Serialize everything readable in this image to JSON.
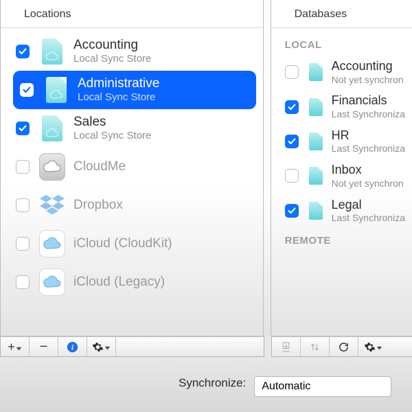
{
  "left": {
    "header": "Locations",
    "items": [
      {
        "title": "Accounting",
        "subtitle": "Local Sync Store",
        "checked": true,
        "icon": "cloud-doc",
        "selected": false,
        "dim": false
      },
      {
        "title": "Administrative",
        "subtitle": "Local Sync Store",
        "checked": true,
        "icon": "cloud-doc",
        "selected": true,
        "dim": false
      },
      {
        "title": "Sales",
        "subtitle": "Local Sync Store",
        "checked": true,
        "icon": "cloud-doc",
        "selected": false,
        "dim": false
      },
      {
        "title": "CloudMe",
        "subtitle": "",
        "checked": false,
        "icon": "cloudme",
        "selected": false,
        "dim": true
      },
      {
        "title": "Dropbox",
        "subtitle": "",
        "checked": false,
        "icon": "dropbox",
        "selected": false,
        "dim": true
      },
      {
        "title": "iCloud (CloudKit)",
        "subtitle": "",
        "checked": false,
        "icon": "icloud",
        "selected": false,
        "dim": true
      },
      {
        "title": "iCloud (Legacy)",
        "subtitle": "",
        "checked": false,
        "icon": "icloud",
        "selected": false,
        "dim": true
      }
    ],
    "toolbar": {
      "add": "+",
      "remove": "−",
      "info": "i",
      "gear": "gear"
    }
  },
  "right": {
    "header": "Databases",
    "section_local": "LOCAL",
    "section_remote": "REMOTE",
    "items": [
      {
        "title": "Accounting",
        "subtitle": "Not yet synchron",
        "checked": false
      },
      {
        "title": "Financials",
        "subtitle": "Last Synchroniza",
        "checked": true
      },
      {
        "title": "HR",
        "subtitle": "Last Synchroniza",
        "checked": true
      },
      {
        "title": "Inbox",
        "subtitle": "Not yet synchron",
        "checked": false
      },
      {
        "title": "Legal",
        "subtitle": "Last Synchroniza",
        "checked": true
      }
    ],
    "toolbar": {
      "download": "download",
      "swap": "swap",
      "refresh": "refresh",
      "gear": "gear"
    }
  },
  "footer": {
    "label": "Synchronize:",
    "value": "Automatic"
  }
}
